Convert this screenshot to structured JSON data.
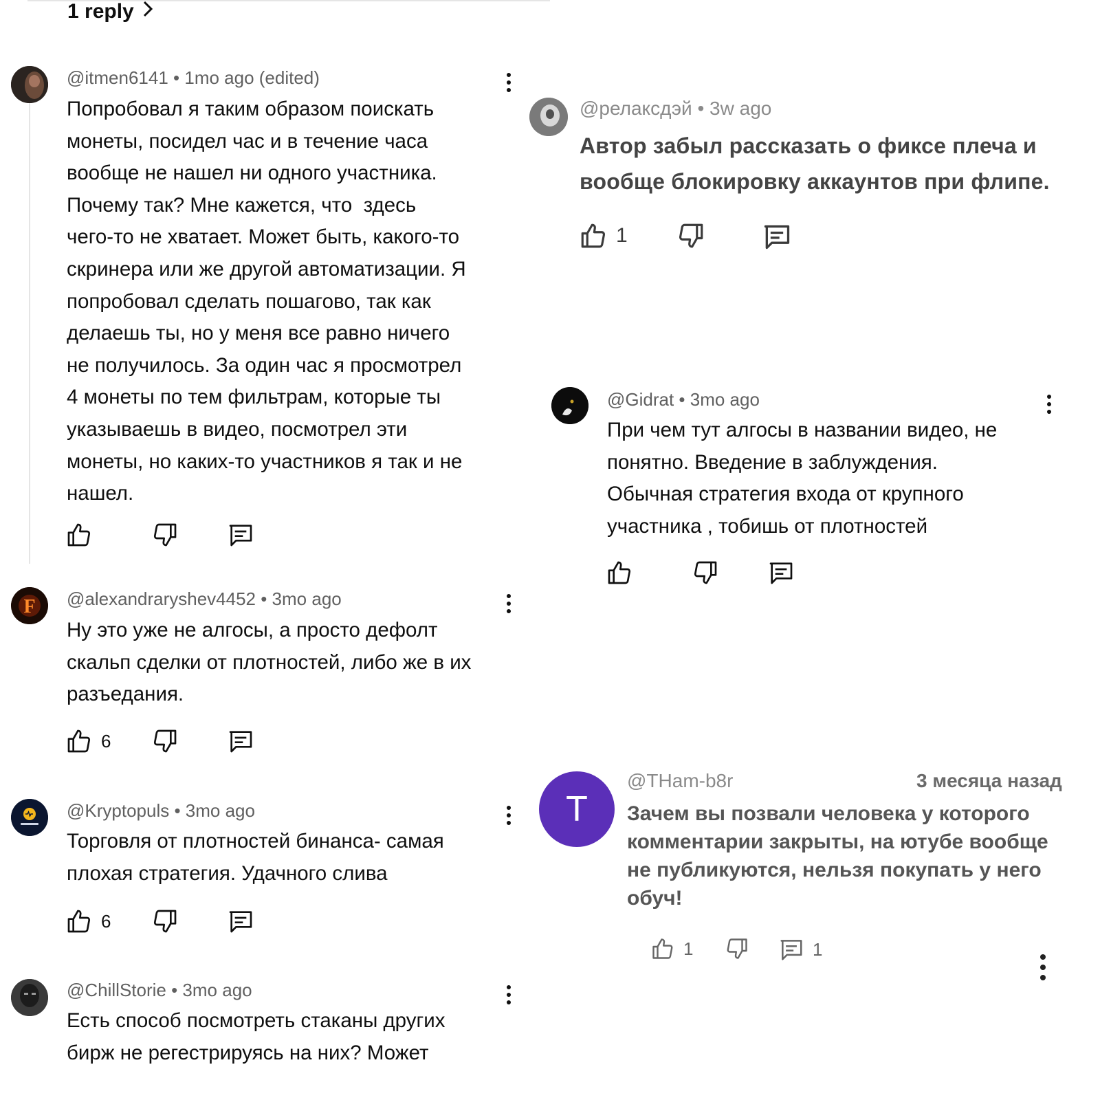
{
  "thread": {
    "reply_link": "1 reply"
  },
  "left_comments": [
    {
      "meta": "@itmen6141 • 1mo ago (edited)",
      "lines": [
        "Попробовал я таким образом поискать",
        "монеты, посидел час и в течение часа",
        "вообще не нашел ни одного участника.",
        "Почему так? Мне кажется, что  здесь",
        "чего-то не хватает. Может быть, какого-то",
        "скринера или же другой автоматизации. Я",
        "попробовал сделать пошагово, так как",
        "делаешь ты, но у меня все равно ничего",
        "не получилось. За один час я просмотрел",
        "4 монеты по тем фильтрам, которые ты",
        "указываешь в видео, посмотрел эти",
        "монеты, но каких-то участников я так и не",
        "нашел."
      ],
      "likes": ""
    },
    {
      "meta": "@alexandraryshev4452 • 3mo ago",
      "lines": [
        "Ну это уже не алгосы, а просто дефолт",
        "скальп сделки от плотностей, либо же в их",
        "разъедания."
      ],
      "likes": "6",
      "avatar_letter": "F"
    },
    {
      "meta": "@Kryptopuls • 3mo ago",
      "lines": [
        "Торговля от плотностей бинанса- самая",
        "плохая стратегия. Удачного слива"
      ],
      "likes": "6"
    },
    {
      "meta": "@ChillStorie • 3mo ago",
      "lines": [
        "Есть способ посмотреть стаканы других",
        "бирж не регестрируясь на них? Может"
      ],
      "likes": ""
    }
  ],
  "right_comments": [
    {
      "meta": "@релаксдэй • 3w ago",
      "lines": [
        "Автор забыл рассказать о фиксе плеча и",
        "вообще блокировку аккаунтов при флипе."
      ],
      "likes": "1"
    },
    {
      "meta": "@Gidrat • 3mo ago",
      "lines": [
        "При чем тут алгосы в названии видео, не",
        "понятно. Введение в заблуждения.",
        "Обычная стратегия входа от крупного",
        "участника , тобишь от плотностей"
      ],
      "likes": ""
    },
    {
      "meta": "@THam-b8r",
      "time": "3 месяца назад",
      "avatar_letter": "T",
      "lines": [
        "Зачем вы позвали человека у которого",
        "комментарии закрыты, на ютубе вообще",
        "не публикуются, нельзя покупать у него",
        "обуч!"
      ],
      "likes": "1",
      "replies": "1"
    }
  ],
  "colors": {
    "text": "#0f0f0f",
    "meta": "#606060",
    "avatar_purple": "#5b2fb8",
    "divider": "#e5e5e5"
  }
}
